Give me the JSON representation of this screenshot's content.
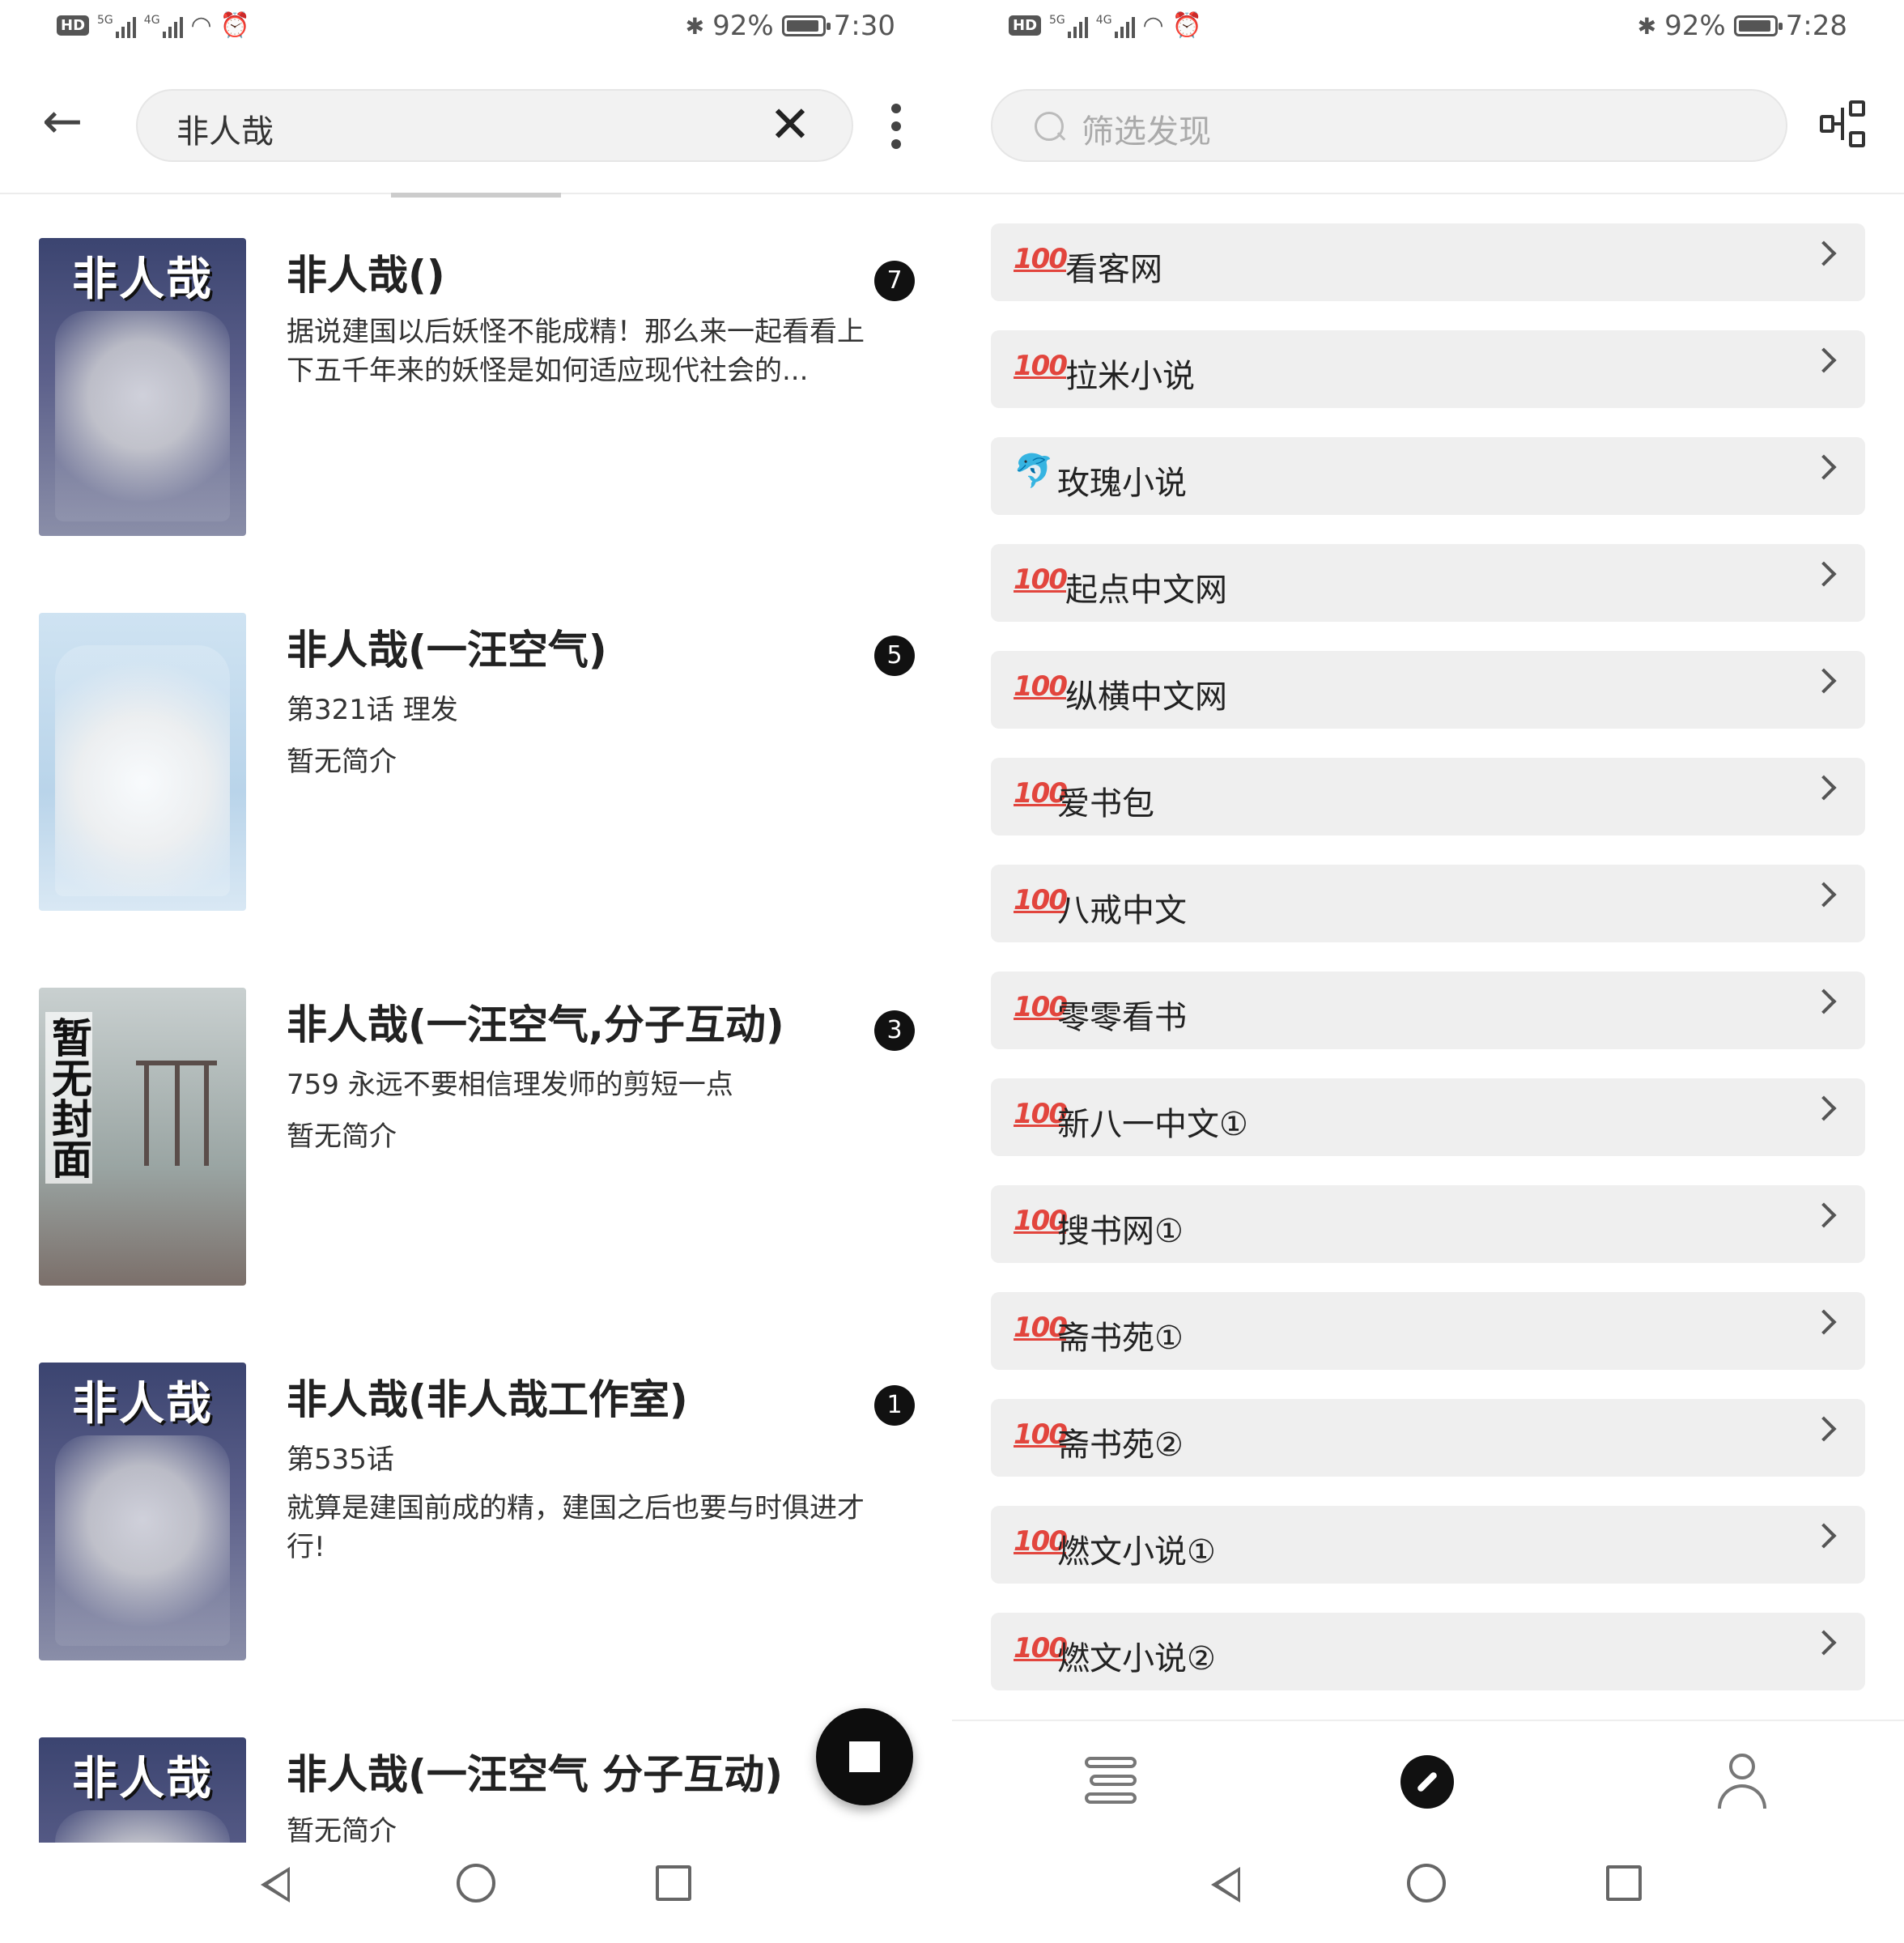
{
  "left": {
    "status": {
      "hd": "HD",
      "sim1": "5G",
      "sim2": "4G",
      "battery_text": "92%",
      "battery_level": 0.92,
      "time": "7:30"
    },
    "search": {
      "query": "非人哉",
      "clear_icon": "close-icon",
      "menu_icon": "more-vertical-icon",
      "back_icon": "arrow-back-icon"
    },
    "results": [
      {
        "title": "非人哉()",
        "line1": "据说建国以后妖怪不能成精！那么来一起看看上下五千年来的妖怪是如何适应现代社会的...",
        "line2": "",
        "count": "7",
        "cover_text": "非人哉",
        "cover_style": "dark"
      },
      {
        "title": "非人哉(一汪空气)",
        "line1": "第321话 理发",
        "line2": "暂无简介",
        "count": "5",
        "cover_text": "",
        "cover_style": "light"
      },
      {
        "title": "非人哉(一汪空气,分子互动)",
        "line1": "759 永远不要相信理发师的剪短一点",
        "line2": "暂无简介",
        "count": "3",
        "cover_text": "暂无封面",
        "cover_style": "none"
      },
      {
        "title": "非人哉(非人哉工作室)",
        "line1": "第535话",
        "line2": "就算是建国前成的精，建国之后也要与时俱进才行!",
        "count": "1",
        "cover_text": "非人哉",
        "cover_style": "dark"
      },
      {
        "title": "非人哉(一汪空气 分子互动)",
        "line1": "暂无简介",
        "line2": "",
        "count": "",
        "cover_text": "非人哉",
        "cover_style": "dark"
      }
    ],
    "fab_icon": "stop-icon"
  },
  "right": {
    "status": {
      "hd": "HD",
      "sim1": "5G",
      "sim2": "4G",
      "battery_text": "92%",
      "battery_level": 0.92,
      "time": "7:28"
    },
    "filter": {
      "placeholder": "筛选发现",
      "icon": "search-icon",
      "tree_icon": "sitemap-icon"
    },
    "sources": [
      {
        "icon_text": "100",
        "label": "看客网",
        "spaced": true
      },
      {
        "icon_text": "100",
        "label": "拉米小说",
        "spaced": true
      },
      {
        "icon_text": "🐬",
        "label": "玫瑰小说",
        "spaced": false,
        "dolphin": true
      },
      {
        "icon_text": "100",
        "label": "起点中文网",
        "spaced": true
      },
      {
        "icon_text": "100",
        "label": "纵横中文网",
        "spaced": true
      },
      {
        "icon_text": "100",
        "label": "爱书包",
        "spaced": false
      },
      {
        "icon_text": "100",
        "label": "八戒中文",
        "spaced": false
      },
      {
        "icon_text": "100",
        "label": "零零看书",
        "spaced": false
      },
      {
        "icon_text": "100",
        "label": "新八一中文①",
        "spaced": false
      },
      {
        "icon_text": "100",
        "label": "搜书网①",
        "spaced": false
      },
      {
        "icon_text": "100",
        "label": "斋书苑①",
        "spaced": false
      },
      {
        "icon_text": "100",
        "label": "斋书苑②",
        "spaced": false
      },
      {
        "icon_text": "100",
        "label": "燃文小说①",
        "spaced": false
      },
      {
        "icon_text": "100",
        "label": "燃文小说②",
        "spaced": false
      }
    ],
    "tabs": [
      {
        "name": "bookshelf",
        "icon": "bookshelf-icon",
        "active": false
      },
      {
        "name": "discover",
        "icon": "compass-icon",
        "active": true
      },
      {
        "name": "me",
        "icon": "user-icon",
        "active": false
      }
    ]
  },
  "system_nav": {
    "back_icon": "nav-back-icon",
    "home_icon": "nav-home-icon",
    "recent_icon": "nav-recent-icon"
  }
}
